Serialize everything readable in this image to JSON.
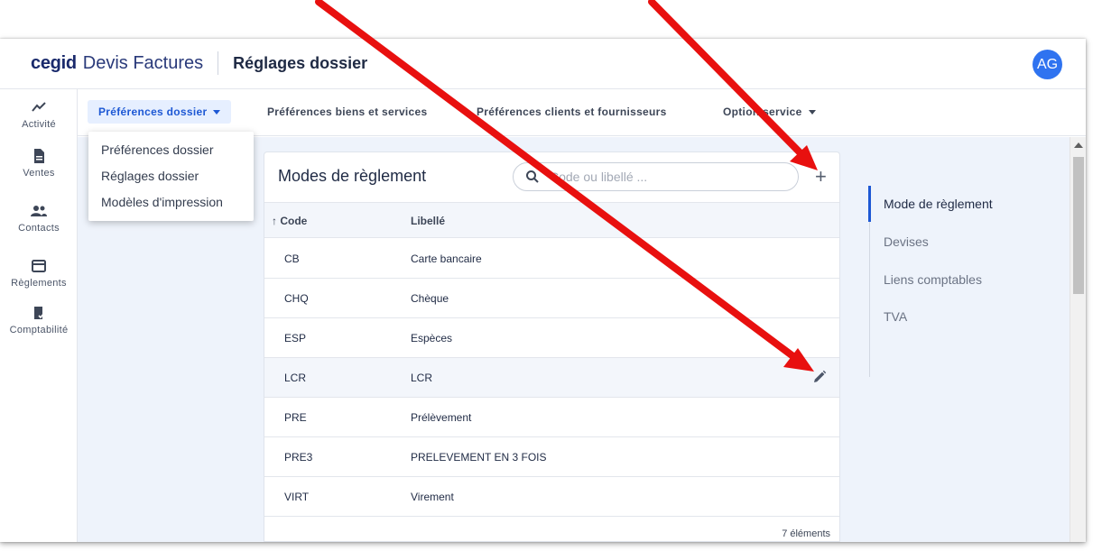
{
  "header": {
    "brand": "cegid",
    "product": "Devis Factures",
    "page_title": "Réglages dossier",
    "avatar_initials": "AG"
  },
  "left_nav": {
    "items": [
      {
        "label": "Activité",
        "icon": "activity-chart-icon"
      },
      {
        "label": "Ventes",
        "icon": "document-icon"
      },
      {
        "label": "Contacts",
        "icon": "people-icon"
      },
      {
        "label": "Règlements",
        "icon": "credit-card-icon"
      },
      {
        "label": "Comptabilité",
        "icon": "ledger-check-icon"
      }
    ]
  },
  "tabs": [
    {
      "label": "Préférences dossier",
      "active": true,
      "has_dropdown": true
    },
    {
      "label": "Préférences biens et services",
      "active": false,
      "has_dropdown": false
    },
    {
      "label": "Préférences clients et fournisseurs",
      "active": false,
      "has_dropdown": false
    },
    {
      "label": "Option service",
      "active": false,
      "has_dropdown": true
    }
  ],
  "dropdown": {
    "options": [
      "Préférences dossier",
      "Réglages dossier",
      "Modèles d'impression"
    ]
  },
  "card": {
    "title": "Modes de règlement",
    "search_placeholder": "Code ou libellé ...",
    "add_label": "+",
    "columns": {
      "code": "↑ Code",
      "label": "Libellé"
    },
    "rows": [
      {
        "code": "CB",
        "label": "Carte bancaire"
      },
      {
        "code": "CHQ",
        "label": "Chèque"
      },
      {
        "code": "ESP",
        "label": "Espèces"
      },
      {
        "code": "LCR",
        "label": "LCR"
      },
      {
        "code": "PRE",
        "label": "Prélèvement"
      },
      {
        "code": "PRE3",
        "label": "PRELEVEMENT EN 3 FOIS"
      },
      {
        "code": "VIRT",
        "label": "Virement"
      }
    ],
    "hovered_row": 3,
    "count_label": "7 éléments"
  },
  "sub_nav": {
    "items": [
      "Mode de règlement",
      "Devises",
      "Liens comptables",
      "TVA"
    ],
    "active": 0
  },
  "colors": {
    "brand_navy": "#1a2a6c",
    "accent_blue": "#1d58d4",
    "avatar_blue": "#2f73f0",
    "annotation_red": "#e8100f",
    "content_bg": "#eef3fb"
  }
}
